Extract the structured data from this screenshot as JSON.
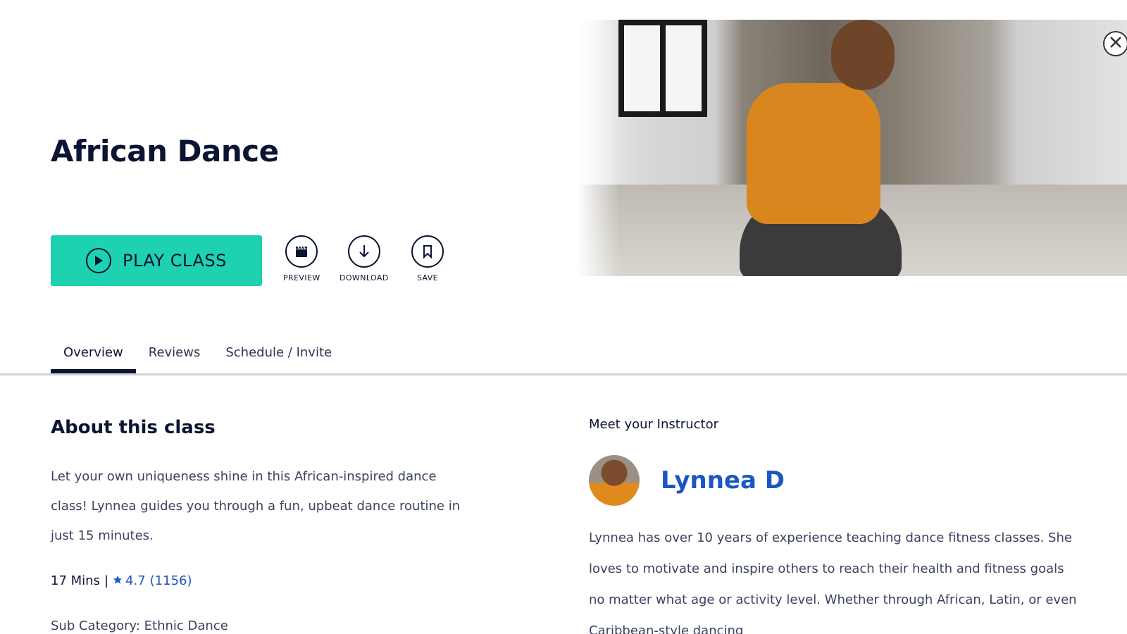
{
  "class": {
    "title": "African Dance",
    "play_label": "PLAY CLASS",
    "actions": {
      "preview": "PREVIEW",
      "download": "DOWNLOAD",
      "save": "SAVE"
    }
  },
  "tabs": [
    {
      "label": "Overview",
      "active": true
    },
    {
      "label": "Reviews",
      "active": false
    },
    {
      "label": "Schedule / Invite",
      "active": false
    }
  ],
  "about": {
    "title": "About this class",
    "description": "Let your own uniqueness shine in this African-inspired dance class! Lynnea guides you through a fun, upbeat dance routine in just 15 minutes.",
    "duration": "17 Mins",
    "separator": "|",
    "rating": "4.7",
    "rating_count": "(1156)",
    "subcategory": "Sub Category: Ethnic Dance"
  },
  "instructor": {
    "heading": "Meet your Instructor",
    "name": "Lynnea D",
    "bio": "Lynnea has over 10 years of experience teaching dance fitness classes. She loves to motivate and inspire others to reach their health and fitness goals no matter what age or activity level. Whether through African, Latin, or even Caribbean-style dancing"
  },
  "colors": {
    "accent": "#1ed1b0",
    "navy": "#0b1433",
    "link": "#1a56c4"
  },
  "icons": {
    "play": "play-circle-icon",
    "preview": "clapperboard-icon",
    "download": "download-arrow-icon",
    "save": "bookmark-icon",
    "close": "close-icon",
    "star": "star-icon"
  }
}
